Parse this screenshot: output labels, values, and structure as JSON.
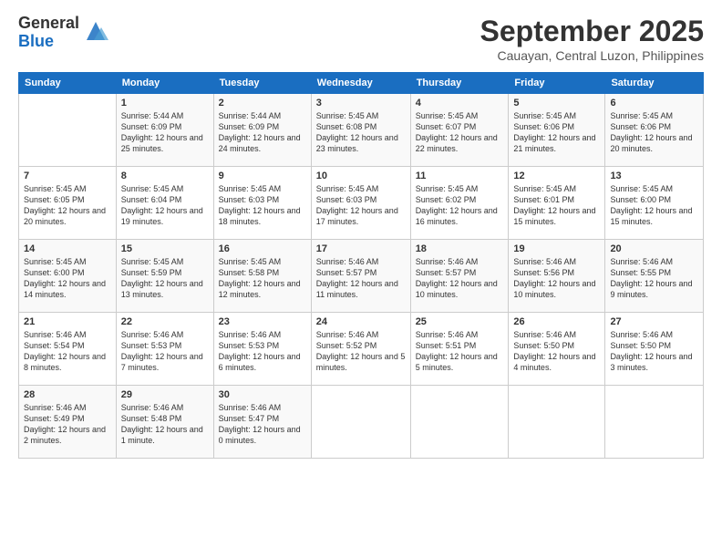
{
  "logo": {
    "general": "General",
    "blue": "Blue"
  },
  "header": {
    "month": "September 2025",
    "location": "Cauayan, Central Luzon, Philippines"
  },
  "weekdays": [
    "Sunday",
    "Monday",
    "Tuesday",
    "Wednesday",
    "Thursday",
    "Friday",
    "Saturday"
  ],
  "weeks": [
    [
      {
        "day": "",
        "sunrise": "",
        "sunset": "",
        "daylight": ""
      },
      {
        "day": "1",
        "sunrise": "Sunrise: 5:44 AM",
        "sunset": "Sunset: 6:09 PM",
        "daylight": "Daylight: 12 hours and 25 minutes."
      },
      {
        "day": "2",
        "sunrise": "Sunrise: 5:44 AM",
        "sunset": "Sunset: 6:09 PM",
        "daylight": "Daylight: 12 hours and 24 minutes."
      },
      {
        "day": "3",
        "sunrise": "Sunrise: 5:45 AM",
        "sunset": "Sunset: 6:08 PM",
        "daylight": "Daylight: 12 hours and 23 minutes."
      },
      {
        "day": "4",
        "sunrise": "Sunrise: 5:45 AM",
        "sunset": "Sunset: 6:07 PM",
        "daylight": "Daylight: 12 hours and 22 minutes."
      },
      {
        "day": "5",
        "sunrise": "Sunrise: 5:45 AM",
        "sunset": "Sunset: 6:06 PM",
        "daylight": "Daylight: 12 hours and 21 minutes."
      },
      {
        "day": "6",
        "sunrise": "Sunrise: 5:45 AM",
        "sunset": "Sunset: 6:06 PM",
        "daylight": "Daylight: 12 hours and 20 minutes."
      }
    ],
    [
      {
        "day": "7",
        "sunrise": "Sunrise: 5:45 AM",
        "sunset": "Sunset: 6:05 PM",
        "daylight": "Daylight: 12 hours and 20 minutes."
      },
      {
        "day": "8",
        "sunrise": "Sunrise: 5:45 AM",
        "sunset": "Sunset: 6:04 PM",
        "daylight": "Daylight: 12 hours and 19 minutes."
      },
      {
        "day": "9",
        "sunrise": "Sunrise: 5:45 AM",
        "sunset": "Sunset: 6:03 PM",
        "daylight": "Daylight: 12 hours and 18 minutes."
      },
      {
        "day": "10",
        "sunrise": "Sunrise: 5:45 AM",
        "sunset": "Sunset: 6:03 PM",
        "daylight": "Daylight: 12 hours and 17 minutes."
      },
      {
        "day": "11",
        "sunrise": "Sunrise: 5:45 AM",
        "sunset": "Sunset: 6:02 PM",
        "daylight": "Daylight: 12 hours and 16 minutes."
      },
      {
        "day": "12",
        "sunrise": "Sunrise: 5:45 AM",
        "sunset": "Sunset: 6:01 PM",
        "daylight": "Daylight: 12 hours and 15 minutes."
      },
      {
        "day": "13",
        "sunrise": "Sunrise: 5:45 AM",
        "sunset": "Sunset: 6:00 PM",
        "daylight": "Daylight: 12 hours and 15 minutes."
      }
    ],
    [
      {
        "day": "14",
        "sunrise": "Sunrise: 5:45 AM",
        "sunset": "Sunset: 6:00 PM",
        "daylight": "Daylight: 12 hours and 14 minutes."
      },
      {
        "day": "15",
        "sunrise": "Sunrise: 5:45 AM",
        "sunset": "Sunset: 5:59 PM",
        "daylight": "Daylight: 12 hours and 13 minutes."
      },
      {
        "day": "16",
        "sunrise": "Sunrise: 5:45 AM",
        "sunset": "Sunset: 5:58 PM",
        "daylight": "Daylight: 12 hours and 12 minutes."
      },
      {
        "day": "17",
        "sunrise": "Sunrise: 5:46 AM",
        "sunset": "Sunset: 5:57 PM",
        "daylight": "Daylight: 12 hours and 11 minutes."
      },
      {
        "day": "18",
        "sunrise": "Sunrise: 5:46 AM",
        "sunset": "Sunset: 5:57 PM",
        "daylight": "Daylight: 12 hours and 10 minutes."
      },
      {
        "day": "19",
        "sunrise": "Sunrise: 5:46 AM",
        "sunset": "Sunset: 5:56 PM",
        "daylight": "Daylight: 12 hours and 10 minutes."
      },
      {
        "day": "20",
        "sunrise": "Sunrise: 5:46 AM",
        "sunset": "Sunset: 5:55 PM",
        "daylight": "Daylight: 12 hours and 9 minutes."
      }
    ],
    [
      {
        "day": "21",
        "sunrise": "Sunrise: 5:46 AM",
        "sunset": "Sunset: 5:54 PM",
        "daylight": "Daylight: 12 hours and 8 minutes."
      },
      {
        "day": "22",
        "sunrise": "Sunrise: 5:46 AM",
        "sunset": "Sunset: 5:53 PM",
        "daylight": "Daylight: 12 hours and 7 minutes."
      },
      {
        "day": "23",
        "sunrise": "Sunrise: 5:46 AM",
        "sunset": "Sunset: 5:53 PM",
        "daylight": "Daylight: 12 hours and 6 minutes."
      },
      {
        "day": "24",
        "sunrise": "Sunrise: 5:46 AM",
        "sunset": "Sunset: 5:52 PM",
        "daylight": "Daylight: 12 hours and 5 minutes."
      },
      {
        "day": "25",
        "sunrise": "Sunrise: 5:46 AM",
        "sunset": "Sunset: 5:51 PM",
        "daylight": "Daylight: 12 hours and 5 minutes."
      },
      {
        "day": "26",
        "sunrise": "Sunrise: 5:46 AM",
        "sunset": "Sunset: 5:50 PM",
        "daylight": "Daylight: 12 hours and 4 minutes."
      },
      {
        "day": "27",
        "sunrise": "Sunrise: 5:46 AM",
        "sunset": "Sunset: 5:50 PM",
        "daylight": "Daylight: 12 hours and 3 minutes."
      }
    ],
    [
      {
        "day": "28",
        "sunrise": "Sunrise: 5:46 AM",
        "sunset": "Sunset: 5:49 PM",
        "daylight": "Daylight: 12 hours and 2 minutes."
      },
      {
        "day": "29",
        "sunrise": "Sunrise: 5:46 AM",
        "sunset": "Sunset: 5:48 PM",
        "daylight": "Daylight: 12 hours and 1 minute."
      },
      {
        "day": "30",
        "sunrise": "Sunrise: 5:46 AM",
        "sunset": "Sunset: 5:47 PM",
        "daylight": "Daylight: 12 hours and 0 minutes."
      },
      {
        "day": "",
        "sunrise": "",
        "sunset": "",
        "daylight": ""
      },
      {
        "day": "",
        "sunrise": "",
        "sunset": "",
        "daylight": ""
      },
      {
        "day": "",
        "sunrise": "",
        "sunset": "",
        "daylight": ""
      },
      {
        "day": "",
        "sunrise": "",
        "sunset": "",
        "daylight": ""
      }
    ]
  ]
}
